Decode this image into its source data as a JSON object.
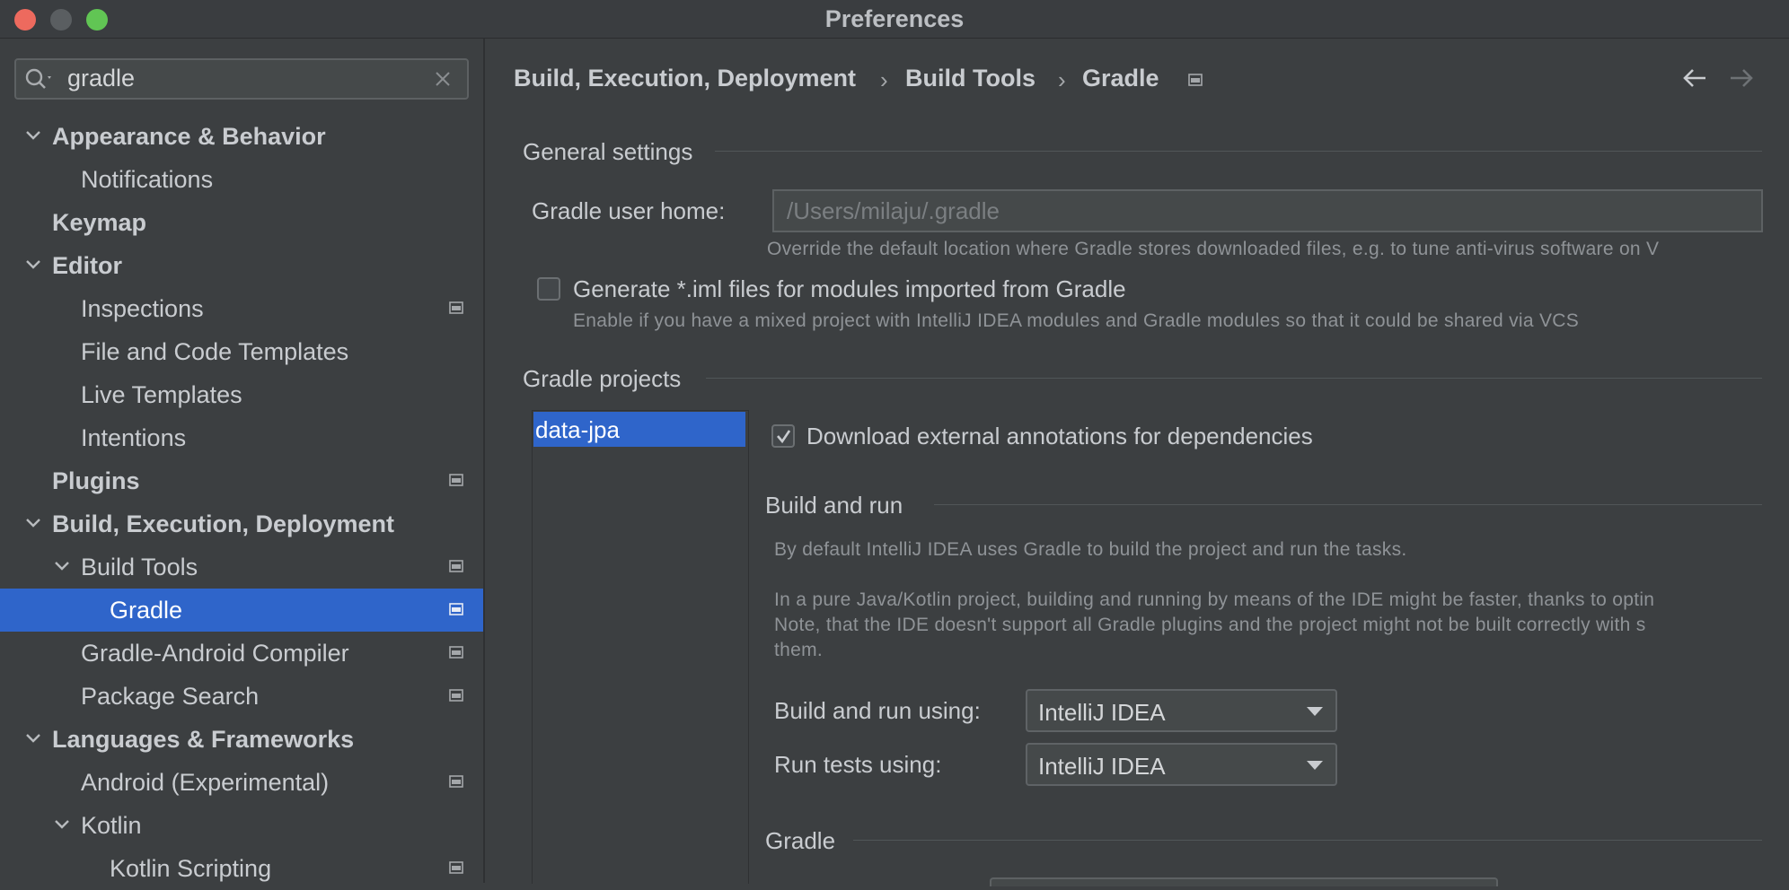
{
  "window": {
    "title": "Preferences",
    "traffic_colors": {
      "close": "#ed6a5e",
      "minimize": "#5a5e61",
      "maximize": "#61c554"
    }
  },
  "search": {
    "value": "gradle",
    "search_icon": "search-icon",
    "clear_icon": "close-icon"
  },
  "sidebar": {
    "items": [
      {
        "label": "Appearance & Behavior",
        "bold": true,
        "chevron": "down"
      },
      {
        "label": "Notifications"
      },
      {
        "label": "Keymap",
        "bold": true
      },
      {
        "label": "Editor",
        "bold": true,
        "chevron": "down"
      },
      {
        "label": "Inspections",
        "project_icon": true
      },
      {
        "label": "File and Code Templates"
      },
      {
        "label": "Live Templates"
      },
      {
        "label": "Intentions"
      },
      {
        "label": "Plugins",
        "bold": true,
        "project_icon": true
      },
      {
        "label": "Build, Execution, Deployment",
        "bold": true,
        "chevron": "down"
      },
      {
        "label": "Build Tools",
        "chevron": "down",
        "project_icon": true
      },
      {
        "label": "Gradle",
        "selected": true,
        "project_icon": true
      },
      {
        "label": "Gradle-Android Compiler",
        "project_icon": true
      },
      {
        "label": "Package Search",
        "project_icon": true
      },
      {
        "label": "Languages & Frameworks",
        "bold": true,
        "chevron": "down"
      },
      {
        "label": "Android (Experimental)",
        "project_icon": true
      },
      {
        "label": "Kotlin",
        "chevron": "down"
      },
      {
        "label": "Kotlin Scripting",
        "project_icon": true
      }
    ]
  },
  "breadcrumb": {
    "items": [
      "Build, Execution, Deployment",
      "Build Tools",
      "Gradle"
    ],
    "separator": "›",
    "back_icon": "arrow-left-icon",
    "forward_icon": "arrow-right-icon"
  },
  "general": {
    "title": "General settings",
    "user_home_label": "Gradle user home:",
    "user_home_placeholder": "/Users/milaju/.gradle",
    "user_home_hint": "Override the default location where Gradle stores downloaded files, e.g. to tune anti-virus software on V",
    "iml_label": "Generate *.iml files for modules imported from Gradle",
    "iml_checked": false,
    "iml_hint": "Enable if you have a mixed project with IntelliJ IDEA modules and Gradle modules so that it could be shared via VCS"
  },
  "projects": {
    "title": "Gradle projects",
    "list": [
      "data-jpa"
    ],
    "download_annotations_label": "Download external annotations for dependencies",
    "download_annotations_checked": true,
    "build_run": {
      "title": "Build and run",
      "desc1": "By default IntelliJ IDEA uses Gradle to build the project and run the tasks.",
      "desc2": "In a pure Java/Kotlin project, building and running by means of the IDE might be faster, thanks to optin",
      "desc3": "Note, that the IDE doesn't support all Gradle plugins and the project might not be built correctly with s",
      "desc4": "them.",
      "build_using_label": "Build and run using:",
      "build_using_value": "IntelliJ IDEA",
      "tests_using_label": "Run tests using:",
      "tests_using_value": "IntelliJ IDEA"
    },
    "gradle_title": "Gradle"
  },
  "colors": {
    "selection": "#2f65ca",
    "background": "#3c3f41"
  }
}
